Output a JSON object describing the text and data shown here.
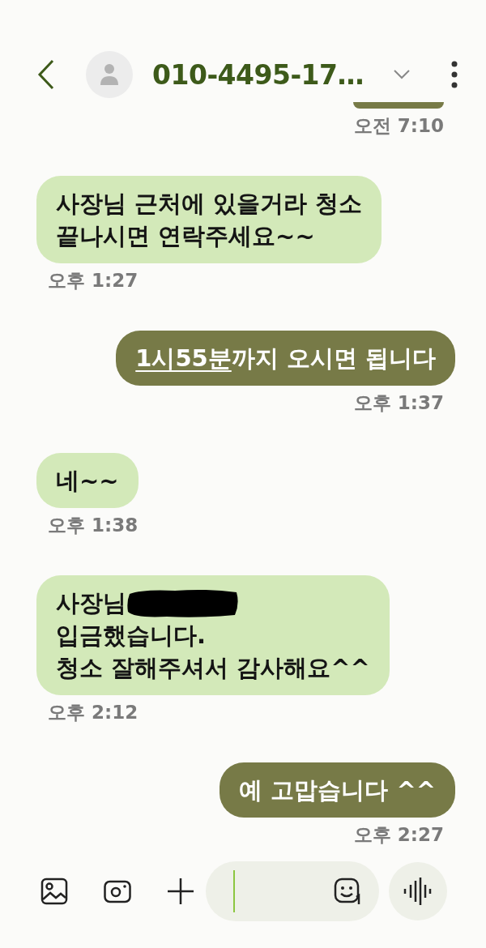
{
  "header": {
    "title": "010-4495-17…"
  },
  "messages": [
    {
      "kind": "sent",
      "clipped": true,
      "time": "오전 7:10"
    },
    {
      "kind": "received",
      "lines": [
        [
          {
            "text": "사장님 근처에 있을거라 청소"
          }
        ],
        [
          {
            "text": "끝나시면 연락주세요~~"
          }
        ]
      ],
      "time": "오후 1:27"
    },
    {
      "kind": "sent",
      "lines": [
        [
          {
            "text": "1시55분",
            "link": true
          },
          {
            "text": "까지 오시면 됩니다"
          }
        ]
      ],
      "time": "오후 1:37"
    },
    {
      "kind": "received",
      "lines": [
        [
          {
            "text": "네~~"
          }
        ]
      ],
      "time": "오후 1:38"
    },
    {
      "kind": "received",
      "lines": [
        [
          {
            "text": "사장님 "
          },
          {
            "redacted": true
          }
        ],
        [
          {
            "text": "입금했습니다."
          }
        ],
        [
          {
            "text": "청소 잘해주셔서 감사해요^^"
          }
        ]
      ],
      "time": "오후 2:12"
    },
    {
      "kind": "sent",
      "lines": [
        [
          {
            "text": "예 고맙습니다 ^^"
          }
        ]
      ],
      "time": "오후 2:27"
    }
  ]
}
